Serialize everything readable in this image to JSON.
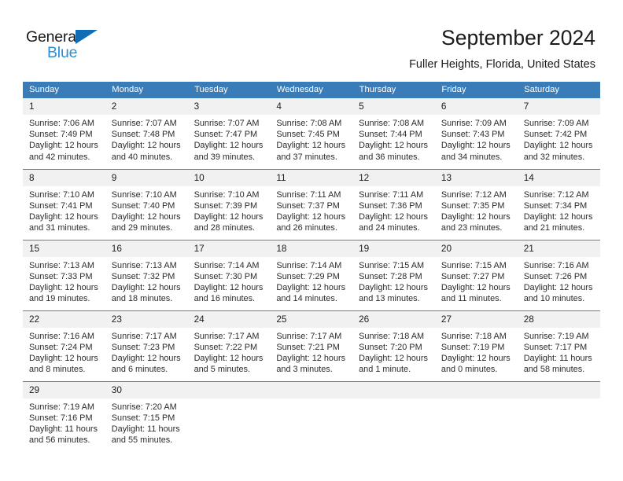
{
  "logo": {
    "word_top": "General",
    "word_bottom": "Blue",
    "triangle_color": "#0f6cb6",
    "blue_color": "#2a8fd4"
  },
  "header": {
    "title": "September 2024",
    "subtitle": "Fuller Heights, Florida, United States"
  },
  "theme": {
    "header_row_bg": "#3a7cb8",
    "daynum_bg": "#f1f1f1",
    "week_separator": "#4a86bd",
    "text": "#2b2b2b"
  },
  "weekday_headers": [
    "Sunday",
    "Monday",
    "Tuesday",
    "Wednesday",
    "Thursday",
    "Friday",
    "Saturday"
  ],
  "weeks": [
    [
      {
        "day": "1",
        "sunrise": "Sunrise: 7:06 AM",
        "sunset": "Sunset: 7:49 PM",
        "daylight1": "Daylight: 12 hours",
        "daylight2": "and 42 minutes."
      },
      {
        "day": "2",
        "sunrise": "Sunrise: 7:07 AM",
        "sunset": "Sunset: 7:48 PM",
        "daylight1": "Daylight: 12 hours",
        "daylight2": "and 40 minutes."
      },
      {
        "day": "3",
        "sunrise": "Sunrise: 7:07 AM",
        "sunset": "Sunset: 7:47 PM",
        "daylight1": "Daylight: 12 hours",
        "daylight2": "and 39 minutes."
      },
      {
        "day": "4",
        "sunrise": "Sunrise: 7:08 AM",
        "sunset": "Sunset: 7:45 PM",
        "daylight1": "Daylight: 12 hours",
        "daylight2": "and 37 minutes."
      },
      {
        "day": "5",
        "sunrise": "Sunrise: 7:08 AM",
        "sunset": "Sunset: 7:44 PM",
        "daylight1": "Daylight: 12 hours",
        "daylight2": "and 36 minutes."
      },
      {
        "day": "6",
        "sunrise": "Sunrise: 7:09 AM",
        "sunset": "Sunset: 7:43 PM",
        "daylight1": "Daylight: 12 hours",
        "daylight2": "and 34 minutes."
      },
      {
        "day": "7",
        "sunrise": "Sunrise: 7:09 AM",
        "sunset": "Sunset: 7:42 PM",
        "daylight1": "Daylight: 12 hours",
        "daylight2": "and 32 minutes."
      }
    ],
    [
      {
        "day": "8",
        "sunrise": "Sunrise: 7:10 AM",
        "sunset": "Sunset: 7:41 PM",
        "daylight1": "Daylight: 12 hours",
        "daylight2": "and 31 minutes."
      },
      {
        "day": "9",
        "sunrise": "Sunrise: 7:10 AM",
        "sunset": "Sunset: 7:40 PM",
        "daylight1": "Daylight: 12 hours",
        "daylight2": "and 29 minutes."
      },
      {
        "day": "10",
        "sunrise": "Sunrise: 7:10 AM",
        "sunset": "Sunset: 7:39 PM",
        "daylight1": "Daylight: 12 hours",
        "daylight2": "and 28 minutes."
      },
      {
        "day": "11",
        "sunrise": "Sunrise: 7:11 AM",
        "sunset": "Sunset: 7:37 PM",
        "daylight1": "Daylight: 12 hours",
        "daylight2": "and 26 minutes."
      },
      {
        "day": "12",
        "sunrise": "Sunrise: 7:11 AM",
        "sunset": "Sunset: 7:36 PM",
        "daylight1": "Daylight: 12 hours",
        "daylight2": "and 24 minutes."
      },
      {
        "day": "13",
        "sunrise": "Sunrise: 7:12 AM",
        "sunset": "Sunset: 7:35 PM",
        "daylight1": "Daylight: 12 hours",
        "daylight2": "and 23 minutes."
      },
      {
        "day": "14",
        "sunrise": "Sunrise: 7:12 AM",
        "sunset": "Sunset: 7:34 PM",
        "daylight1": "Daylight: 12 hours",
        "daylight2": "and 21 minutes."
      }
    ],
    [
      {
        "day": "15",
        "sunrise": "Sunrise: 7:13 AM",
        "sunset": "Sunset: 7:33 PM",
        "daylight1": "Daylight: 12 hours",
        "daylight2": "and 19 minutes."
      },
      {
        "day": "16",
        "sunrise": "Sunrise: 7:13 AM",
        "sunset": "Sunset: 7:32 PM",
        "daylight1": "Daylight: 12 hours",
        "daylight2": "and 18 minutes."
      },
      {
        "day": "17",
        "sunrise": "Sunrise: 7:14 AM",
        "sunset": "Sunset: 7:30 PM",
        "daylight1": "Daylight: 12 hours",
        "daylight2": "and 16 minutes."
      },
      {
        "day": "18",
        "sunrise": "Sunrise: 7:14 AM",
        "sunset": "Sunset: 7:29 PM",
        "daylight1": "Daylight: 12 hours",
        "daylight2": "and 14 minutes."
      },
      {
        "day": "19",
        "sunrise": "Sunrise: 7:15 AM",
        "sunset": "Sunset: 7:28 PM",
        "daylight1": "Daylight: 12 hours",
        "daylight2": "and 13 minutes."
      },
      {
        "day": "20",
        "sunrise": "Sunrise: 7:15 AM",
        "sunset": "Sunset: 7:27 PM",
        "daylight1": "Daylight: 12 hours",
        "daylight2": "and 11 minutes."
      },
      {
        "day": "21",
        "sunrise": "Sunrise: 7:16 AM",
        "sunset": "Sunset: 7:26 PM",
        "daylight1": "Daylight: 12 hours",
        "daylight2": "and 10 minutes."
      }
    ],
    [
      {
        "day": "22",
        "sunrise": "Sunrise: 7:16 AM",
        "sunset": "Sunset: 7:24 PM",
        "daylight1": "Daylight: 12 hours",
        "daylight2": "and 8 minutes."
      },
      {
        "day": "23",
        "sunrise": "Sunrise: 7:17 AM",
        "sunset": "Sunset: 7:23 PM",
        "daylight1": "Daylight: 12 hours",
        "daylight2": "and 6 minutes."
      },
      {
        "day": "24",
        "sunrise": "Sunrise: 7:17 AM",
        "sunset": "Sunset: 7:22 PM",
        "daylight1": "Daylight: 12 hours",
        "daylight2": "and 5 minutes."
      },
      {
        "day": "25",
        "sunrise": "Sunrise: 7:17 AM",
        "sunset": "Sunset: 7:21 PM",
        "daylight1": "Daylight: 12 hours",
        "daylight2": "and 3 minutes."
      },
      {
        "day": "26",
        "sunrise": "Sunrise: 7:18 AM",
        "sunset": "Sunset: 7:20 PM",
        "daylight1": "Daylight: 12 hours",
        "daylight2": "and 1 minute."
      },
      {
        "day": "27",
        "sunrise": "Sunrise: 7:18 AM",
        "sunset": "Sunset: 7:19 PM",
        "daylight1": "Daylight: 12 hours",
        "daylight2": "and 0 minutes."
      },
      {
        "day": "28",
        "sunrise": "Sunrise: 7:19 AM",
        "sunset": "Sunset: 7:17 PM",
        "daylight1": "Daylight: 11 hours",
        "daylight2": "and 58 minutes."
      }
    ],
    [
      {
        "day": "29",
        "sunrise": "Sunrise: 7:19 AM",
        "sunset": "Sunset: 7:16 PM",
        "daylight1": "Daylight: 11 hours",
        "daylight2": "and 56 minutes."
      },
      {
        "day": "30",
        "sunrise": "Sunrise: 7:20 AM",
        "sunset": "Sunset: 7:15 PM",
        "daylight1": "Daylight: 11 hours",
        "daylight2": "and 55 minutes."
      },
      {
        "day": "",
        "sunrise": "",
        "sunset": "",
        "daylight1": "",
        "daylight2": ""
      },
      {
        "day": "",
        "sunrise": "",
        "sunset": "",
        "daylight1": "",
        "daylight2": ""
      },
      {
        "day": "",
        "sunrise": "",
        "sunset": "",
        "daylight1": "",
        "daylight2": ""
      },
      {
        "day": "",
        "sunrise": "",
        "sunset": "",
        "daylight1": "",
        "daylight2": ""
      },
      {
        "day": "",
        "sunrise": "",
        "sunset": "",
        "daylight1": "",
        "daylight2": ""
      }
    ]
  ]
}
